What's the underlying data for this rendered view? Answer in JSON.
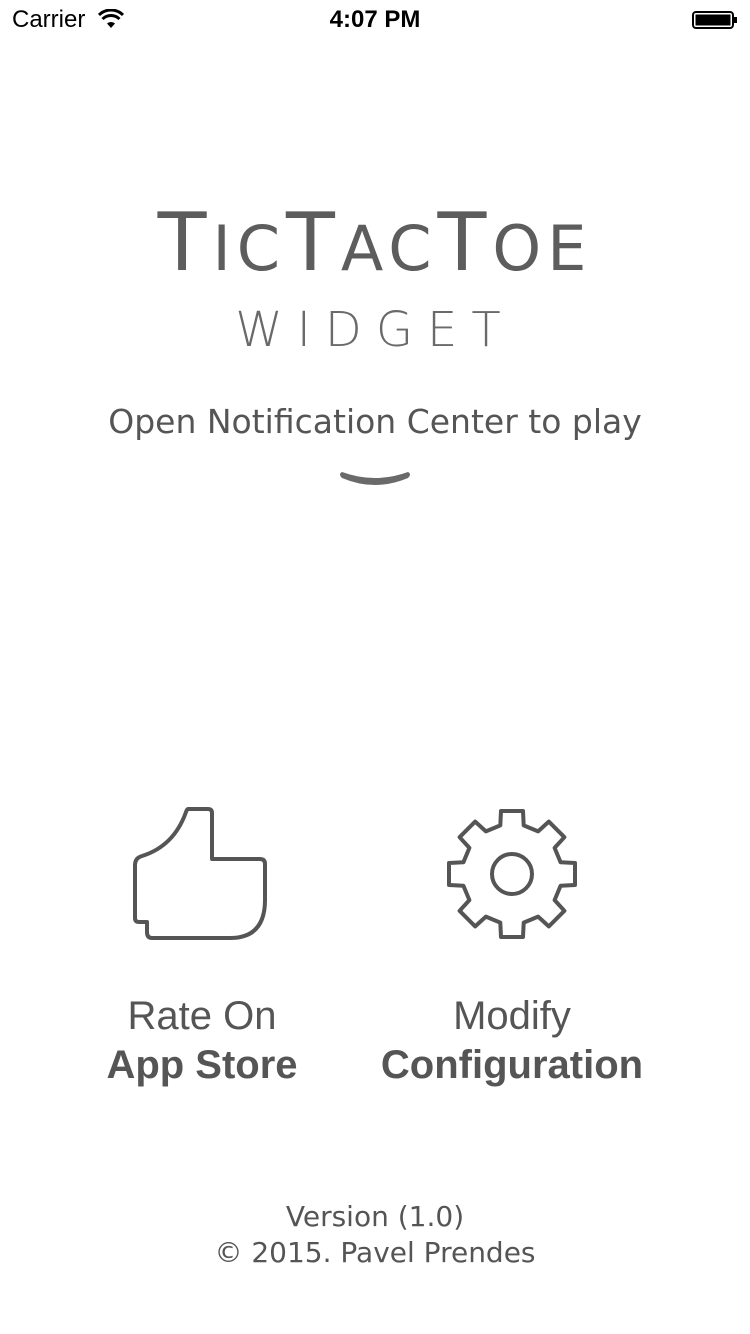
{
  "status_bar": {
    "carrier": "Carrier",
    "time": "4:07 PM",
    "icons": [
      "wifi-icon",
      "battery-icon"
    ]
  },
  "app": {
    "title": "TicTacToe",
    "title_parts": [
      "T",
      "IC",
      "T",
      "AC",
      "T",
      "OE"
    ],
    "subtitle": "WIDGET",
    "hint": "Open Notification Center to play",
    "hint_icon": "chevron-down-icon",
    "text_color": "#555555"
  },
  "actions": [
    {
      "icon": "thumbs-up-icon",
      "line1": "Rate On",
      "line2": "App Store"
    },
    {
      "icon": "gear-icon",
      "line1": "Modify",
      "line2": "Configuration"
    }
  ],
  "footer": {
    "version": "Version (1.0)",
    "copyright": "© 2015. Pavel Prendes"
  }
}
